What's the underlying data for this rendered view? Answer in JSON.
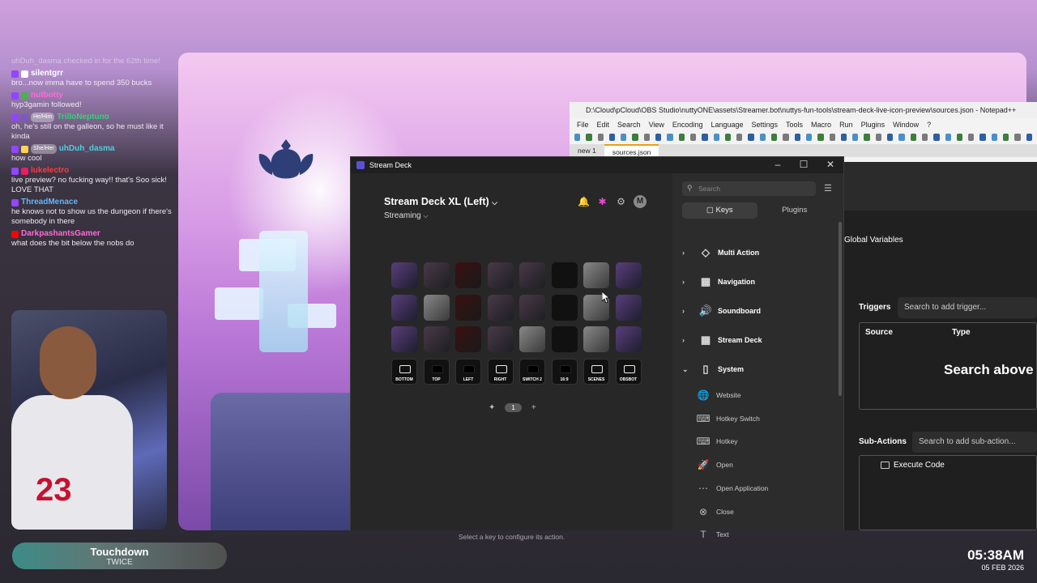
{
  "chat": [
    {
      "user": "silentgrr",
      "color": "#ffffff",
      "platform": "twitch",
      "badge": "#ffffff",
      "msg": "bro...now imma have to spend 350 bucks"
    },
    {
      "user": "nutbotty",
      "color": "#ff6ad5",
      "platform": "twitch",
      "badge": "#4caf50",
      "msg": "hyp3gamin followed!"
    },
    {
      "user": "TrilloNeptuno",
      "color": "#36d17a",
      "platform": "twitch",
      "badge": "#7e57c2",
      "pronoun": "He/Him",
      "msg": "oh, he's still on the galleon, so he must like it kinda"
    },
    {
      "user": "uhDuh_dasma",
      "color": "#4dd0e1",
      "platform": "twitch",
      "badge": "#ffd54f",
      "pronoun": "She/Her",
      "msg": "how cool"
    },
    {
      "user": "lukelectro",
      "color": "#ff3b3b",
      "platform": "twitch",
      "badge": "#e91e63",
      "msg": "live preview? no fucking way!! that's Soo sick! LOVE THAT"
    },
    {
      "user": "ThreadMenace",
      "color": "#64b5f6",
      "platform": "twitch",
      "badge": "",
      "msg": "he knows not to show us the dungeon if there's somebody in there"
    },
    {
      "user": "DarkpashantsGamer",
      "color": "#ff6ad5",
      "platform": "youtube",
      "badge": "",
      "msg": "what does the bit below the nobs do"
    }
  ],
  "chat_top_partial": "uhDuh_dasma checked in for the 62th time!",
  "now_playing": {
    "title": "Touchdown",
    "artist": "TWICE"
  },
  "clock": {
    "time": "05:38AM",
    "date": "05 FEB 2026"
  },
  "notepad": {
    "title": "D:\\Cloud\\pCloud\\OBS Studio\\nuttyONE\\assets\\Streamer.bot\\nuttys-fun-tools\\stream-deck-live-icon-preview\\sources.json - Notepad++",
    "menu": [
      "File",
      "Edit",
      "Search",
      "View",
      "Encoding",
      "Language",
      "Settings",
      "Tools",
      "Macro",
      "Run",
      "Plugins",
      "Window",
      "?"
    ],
    "tabs": [
      "new 1",
      "sources.json"
    ]
  },
  "streamerbot": {
    "global_variables": "Global Variables",
    "triggers_label": "Triggers",
    "triggers_placeholder": "Search to add trigger...",
    "col_source": "Source",
    "col_type": "Type",
    "search_above": "Search above",
    "subactions_label": "Sub-Actions",
    "subactions_placeholder": "Search to add sub-action...",
    "subaction_item": "Execute Code"
  },
  "streamdeck": {
    "window_title": "Stream Deck",
    "device": "Stream Deck XL (Left)",
    "profile": "Streaming",
    "avatar": "M",
    "page": "1",
    "hint": "Select a key to configure its action.",
    "keys_row4": [
      "BOTTOM",
      "TOP",
      "LEFT",
      "RIGHT",
      "SWITCH 2",
      "16:9",
      "SCENES",
      "OBSBOT"
    ],
    "search_placeholder": "Search",
    "tabs": [
      "Keys",
      "Plugins"
    ],
    "categories": [
      "Multi Action",
      "Navigation",
      "Soundboard",
      "Stream Deck",
      "System"
    ],
    "system_actions": [
      "Website",
      "Hotkey Switch",
      "Hotkey",
      "Open",
      "Open Application",
      "Close",
      "Text"
    ]
  }
}
